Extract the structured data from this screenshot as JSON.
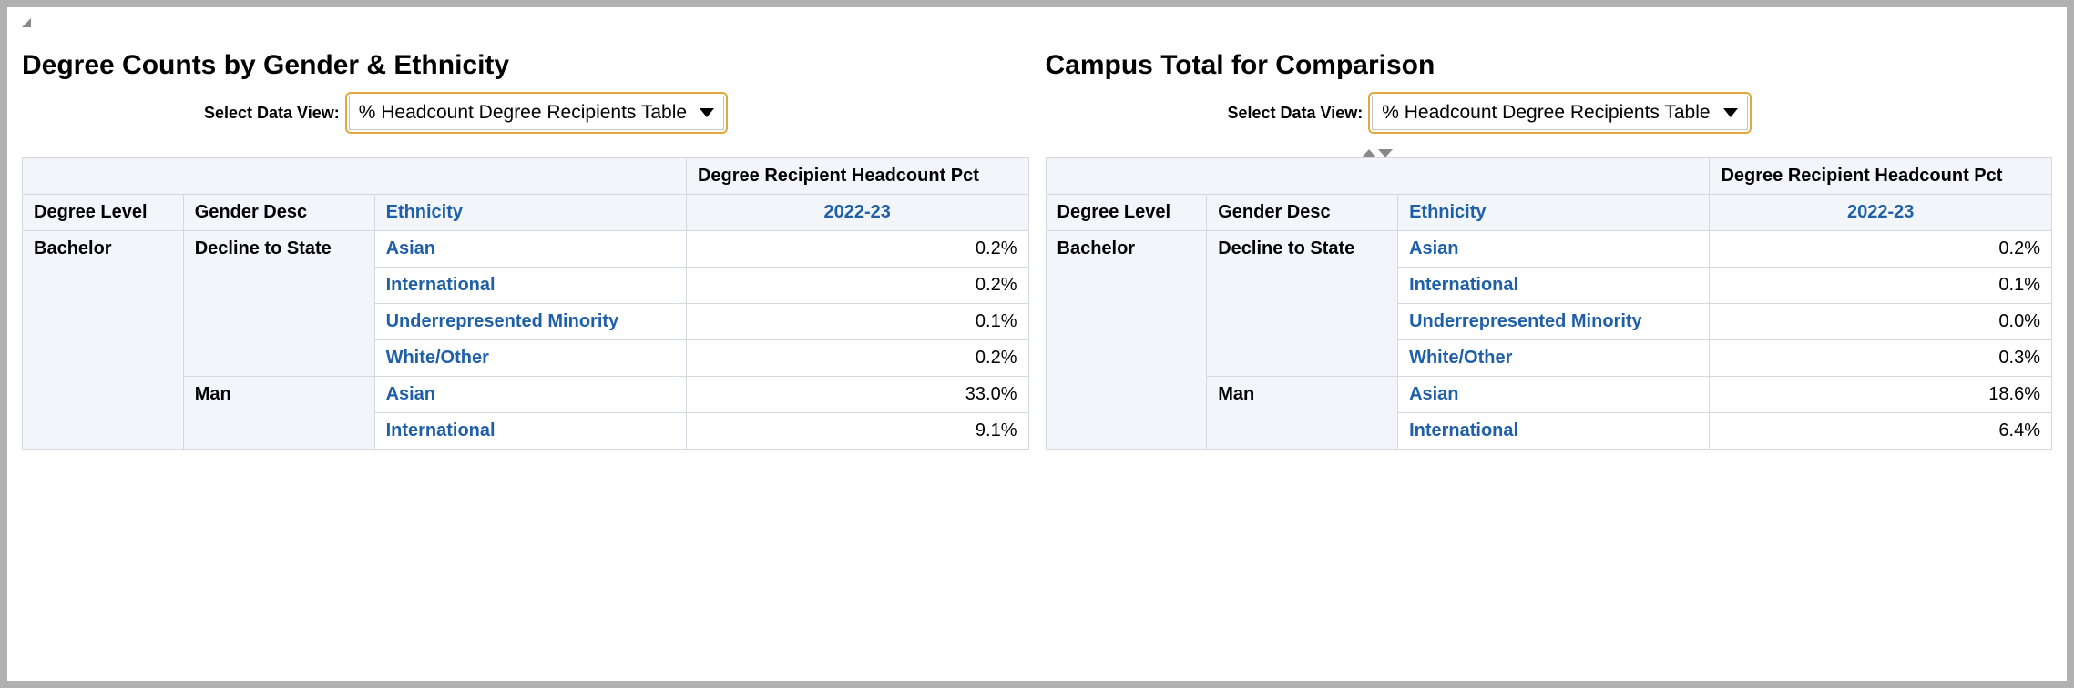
{
  "left": {
    "title": "Degree Counts by Gender & Ethnicity",
    "selector_label": "Select Data View:",
    "selector_value": "% Headcount Degree Recipients Table",
    "pct_header": "Degree Recipient Headcount Pct",
    "year": "2022-23",
    "col_degree": "Degree Level",
    "col_gender": "Gender Desc",
    "col_eth": "Ethnicity",
    "degree": "Bachelor",
    "g1": "Decline to State",
    "g1_eth": [
      "Asian",
      "International",
      "Underrepresented Minority",
      "White/Other"
    ],
    "g1_val": [
      "0.2%",
      "0.2%",
      "0.1%",
      "0.2%"
    ],
    "g2": "Man",
    "g2_eth": [
      "Asian",
      "International"
    ],
    "g2_val": [
      "33.0%",
      "9.1%"
    ]
  },
  "right": {
    "title": "Campus Total for Comparison",
    "selector_label": "Select Data View:",
    "selector_value": "% Headcount Degree Recipients Table",
    "pct_header": "Degree Recipient Headcount Pct",
    "year": "2022-23",
    "col_degree": "Degree Level",
    "col_gender": "Gender Desc",
    "col_eth": "Ethnicity",
    "degree": "Bachelor",
    "g1": "Decline to State",
    "g1_eth": [
      "Asian",
      "International",
      "Underrepresented Minority",
      "White/Other"
    ],
    "g1_val": [
      "0.2%",
      "0.1%",
      "0.0%",
      "0.3%"
    ],
    "g2": "Man",
    "g2_eth": [
      "Asian",
      "International"
    ],
    "g2_val": [
      "18.6%",
      "6.4%"
    ]
  },
  "chart_data": [
    {
      "type": "table",
      "title": "Degree Counts by Gender & Ethnicity — Degree Recipient Headcount Pct 2022-23",
      "degree_level": "Bachelor",
      "rows": [
        {
          "gender": "Decline to State",
          "ethnicity": "Asian",
          "pct": 0.2
        },
        {
          "gender": "Decline to State",
          "ethnicity": "International",
          "pct": 0.2
        },
        {
          "gender": "Decline to State",
          "ethnicity": "Underrepresented Minority",
          "pct": 0.1
        },
        {
          "gender": "Decline to State",
          "ethnicity": "White/Other",
          "pct": 0.2
        },
        {
          "gender": "Man",
          "ethnicity": "Asian",
          "pct": 33.0
        },
        {
          "gender": "Man",
          "ethnicity": "International",
          "pct": 9.1
        }
      ]
    },
    {
      "type": "table",
      "title": "Campus Total for Comparison — Degree Recipient Headcount Pct 2022-23",
      "degree_level": "Bachelor",
      "rows": [
        {
          "gender": "Decline to State",
          "ethnicity": "Asian",
          "pct": 0.2
        },
        {
          "gender": "Decline to State",
          "ethnicity": "International",
          "pct": 0.1
        },
        {
          "gender": "Decline to State",
          "ethnicity": "Underrepresented Minority",
          "pct": 0.0
        },
        {
          "gender": "Decline to State",
          "ethnicity": "White/Other",
          "pct": 0.3
        },
        {
          "gender": "Man",
          "ethnicity": "Asian",
          "pct": 18.6
        },
        {
          "gender": "Man",
          "ethnicity": "International",
          "pct": 6.4
        }
      ]
    }
  ]
}
